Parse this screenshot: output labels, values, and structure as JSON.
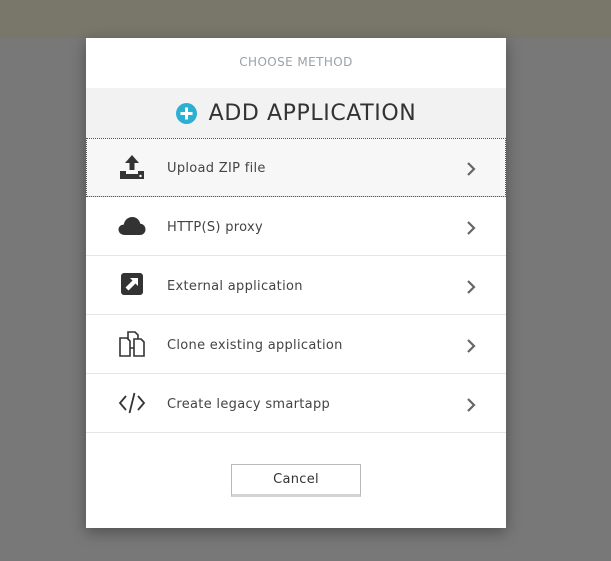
{
  "dialog": {
    "method_label": "CHOOSE METHOD",
    "title": "ADD APPLICATION",
    "title_icon": "plus-circle-icon",
    "accent_color": "#2ab0d2"
  },
  "options": [
    {
      "label": "Upload ZIP file",
      "icon": "upload-icon",
      "focused": true
    },
    {
      "label": "HTTP(S) proxy",
      "icon": "cloud-icon",
      "focused": false
    },
    {
      "label": "External application",
      "icon": "external-link-icon",
      "focused": false
    },
    {
      "label": "Clone existing application",
      "icon": "clone-icon",
      "focused": false
    },
    {
      "label": "Create legacy smartapp",
      "icon": "code-icon",
      "focused": false
    }
  ],
  "footer": {
    "cancel_label": "Cancel"
  },
  "colors": {
    "backdrop": "#787878",
    "icon": "#333333",
    "chevron": "#666666"
  }
}
